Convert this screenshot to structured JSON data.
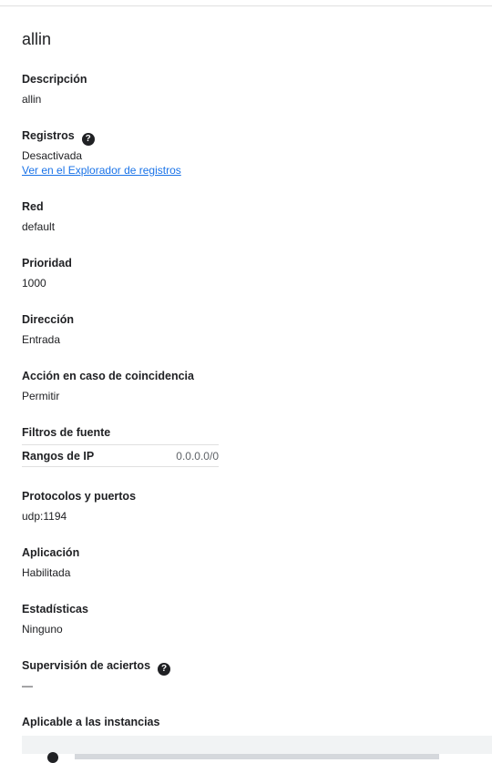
{
  "title": "allin",
  "fields": {
    "descripcion": {
      "label": "Descripción",
      "value": "allin"
    },
    "registros": {
      "label": "Registros",
      "help_icon": "help-circle-icon",
      "value": "Desactivada",
      "link": "Ver en el Explorador de registros"
    },
    "red": {
      "label": "Red",
      "value": "default"
    },
    "prioridad": {
      "label": "Prioridad",
      "value": "1000"
    },
    "direccion": {
      "label": "Dirección",
      "value": "Entrada"
    },
    "accion": {
      "label": "Acción en caso de coincidencia",
      "value": "Permitir"
    },
    "filtros": {
      "label": "Filtros de fuente",
      "rows": [
        {
          "key": "Rangos de IP",
          "value": "0.0.0.0/0"
        }
      ]
    },
    "protocolos": {
      "label": "Protocolos y puertos",
      "value": "udp:1194"
    },
    "aplicacion": {
      "label": "Aplicación",
      "value": "Habilitada"
    },
    "estadisticas": {
      "label": "Estadísticas",
      "value": "Ninguno"
    },
    "supervision": {
      "label": "Supervisión de aciertos",
      "help_icon": "help-circle-icon",
      "value": "—"
    },
    "aplicable": {
      "label": "Aplicable a las instancias"
    }
  },
  "colors": {
    "link": "#1a73e8",
    "text": "#202124",
    "divider": "#e0e0e0",
    "panel": "#f1f3f4"
  }
}
